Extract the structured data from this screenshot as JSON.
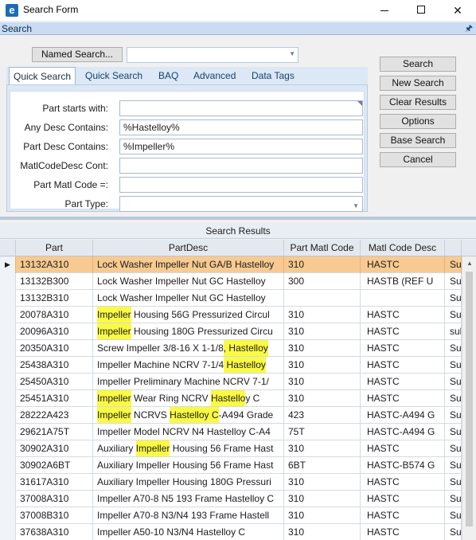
{
  "window": {
    "title": "Search Form",
    "app_icon": "e"
  },
  "section": {
    "title": "Search"
  },
  "named_search": {
    "button_label": "Named Search...",
    "value": ""
  },
  "tabs": [
    {
      "label": "Quick Search",
      "active": true
    },
    {
      "label": "Quick Search",
      "active": false
    },
    {
      "label": "BAQ",
      "active": false
    },
    {
      "label": "Advanced",
      "active": false
    },
    {
      "label": "Data Tags",
      "active": false
    }
  ],
  "form": {
    "fields": [
      {
        "label": "Part starts with:",
        "value": ""
      },
      {
        "label": "Any Desc Contains:",
        "value": "%Hastelloy%"
      },
      {
        "label": "Part Desc Contains:",
        "value": "%Impeller%"
      },
      {
        "label": "MatlCodeDesc Cont:",
        "value": ""
      },
      {
        "label": "Part Matl Code =:",
        "value": ""
      },
      {
        "label": "Part Type:",
        "value": ""
      }
    ]
  },
  "buttons": {
    "search": "Search",
    "new_search": "New Search",
    "clear_results": "Clear Results",
    "options": "Options",
    "base_search": "Base Search",
    "cancel": "Cancel"
  },
  "results": {
    "title": "Search Results",
    "columns": [
      "Part",
      "PartDesc",
      "Part Matl Code",
      "Matl Code Desc",
      ""
    ],
    "highlight_color": "#fafa44",
    "selected_row_color": "#f8ca91",
    "rows": [
      {
        "part": "13132A310",
        "desc": "Lock Washer Impeller Nut GA/B Hastelloy",
        "matl": "310",
        "matl_desc": "HASTC",
        "extra": "Su",
        "selected": true,
        "hl": []
      },
      {
        "part": "13132B300",
        "desc": "Lock Washer Impeller Nut GC Hastelloy",
        "matl": "300",
        "matl_desc": "HASTB (REF U",
        "extra": "Su",
        "hl": []
      },
      {
        "part": "13132B310",
        "desc": "Lock Washer Impeller Nut GC Hastelloy",
        "matl": "",
        "matl_desc": "",
        "extra": "Su",
        "hl": []
      },
      {
        "part": "20078A310",
        "desc": "Impeller Housing 56G Pressurized Circul",
        "matl": "310",
        "matl_desc": "HASTC",
        "extra": "Su",
        "hl": [
          "Impeller"
        ]
      },
      {
        "part": "20096A310",
        "desc": "Impeller Housing 180G Pressurized Circu",
        "matl": "310",
        "matl_desc": "HASTC",
        "extra": "sul",
        "hl": [
          "Impeller"
        ]
      },
      {
        "part": "20350A310",
        "desc": "Screw Impeller 3/8-16 X 1-1/8, Hastelloy",
        "matl": "310",
        "matl_desc": "HASTC",
        "extra": "Su",
        "hl": [
          ", Hastelloy"
        ]
      },
      {
        "part": "25438A310",
        "desc": "Impeller Machine NCRV 7-1/4 Hastelloy",
        "matl": "310",
        "matl_desc": "HASTC",
        "extra": "Su",
        "hl": [
          " Hastelloy"
        ]
      },
      {
        "part": "25450A310",
        "desc": "Impeller Preliminary Machine NCRV 7-1/",
        "matl": "310",
        "matl_desc": "HASTC",
        "extra": "Su",
        "hl": []
      },
      {
        "part": "25451A310",
        "desc": "Impeller Wear Ring NCRV Hastelloy C",
        "matl": "310",
        "matl_desc": "HASTC",
        "extra": "Su",
        "hl": [
          "Impeller",
          "Hastello"
        ]
      },
      {
        "part": "28222A423",
        "desc": "Impeller NCRVS Hastelloy C-A494 Grade",
        "matl": "423",
        "matl_desc": "HASTC-A494 G",
        "extra": "Su",
        "hl": [
          "Impeller",
          "Hastelloy C"
        ]
      },
      {
        "part": "29621A75T",
        "desc": "Impeller Model NCRV N4 Hastelloy C-A4",
        "matl": "75T",
        "matl_desc": "HASTC-A494 G",
        "extra": "Su",
        "hl": []
      },
      {
        "part": "30902A310",
        "desc": "Auxiliary Impeller Housing 56 Frame Hast",
        "matl": "310",
        "matl_desc": "HASTC",
        "extra": "Su",
        "hl": [
          "Impeller"
        ]
      },
      {
        "part": "30902A6BT",
        "desc": "Auxiliary Impeller Housing 56 Frame Hast",
        "matl": "6BT",
        "matl_desc": "HASTC-B574 G",
        "extra": "Su",
        "hl": []
      },
      {
        "part": "31617A310",
        "desc": "Auxiliary Impeller Housing 180G Pressuri",
        "matl": "310",
        "matl_desc": "HASTC",
        "extra": "Su",
        "hl": []
      },
      {
        "part": "37008A310",
        "desc": "Impeller A70-8 N5 193 Frame Hastelloy C",
        "matl": "310",
        "matl_desc": "HASTC",
        "extra": "Su",
        "hl": []
      },
      {
        "part": "37008B310",
        "desc": "Impeller A70-8 N3/N4 193 Frame Hastell",
        "matl": "310",
        "matl_desc": "HASTC",
        "extra": "Su",
        "hl": []
      },
      {
        "part": "37638A310",
        "desc": "Impeller A50-10 N3/N4 Hastelloy C",
        "matl": "310",
        "matl_desc": "HASTC",
        "extra": "Su",
        "hl": []
      }
    ]
  }
}
